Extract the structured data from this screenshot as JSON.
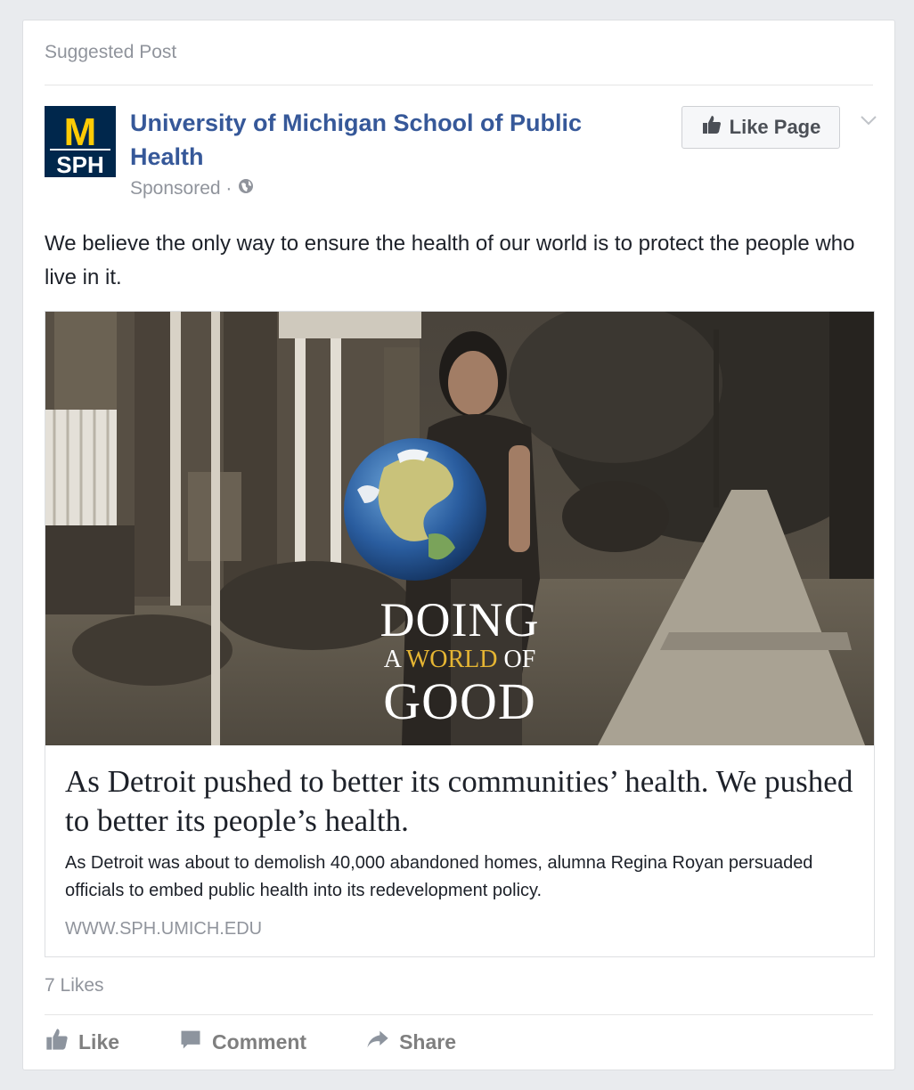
{
  "post": {
    "label": "Suggested Post",
    "page_name": "University of Michigan School of Public Health",
    "logo": {
      "top_text": "M",
      "bottom_text": "SPH",
      "bg_color": "#00274c",
      "accent_color": "#ffcb05"
    },
    "sponsored": "Sponsored ·",
    "like_page_label": "Like Page",
    "text": "We believe the only way to ensure the health of our world is to protect the people who live in it."
  },
  "link": {
    "image_overlay": {
      "line1": "DOING",
      "line2_a": "A ",
      "line2_b": "WORLD",
      "line2_c": " OF",
      "line3": "GOOD"
    },
    "headline": "As Detroit pushed to better its communities’ health. We pushed to better its people’s health.",
    "description": "As Detroit was about to demolish 40,000 abandoned homes, alumna Regina Royan persuaded officials to embed public health into its redevelopment policy.",
    "domain": "WWW.SPH.UMICH.EDU"
  },
  "footer": {
    "likes": "7 Likes",
    "actions": {
      "like": "Like",
      "comment": "Comment",
      "share": "Share"
    }
  },
  "icons": {
    "thumbs_up": "thumbs-up-icon",
    "comment": "comment-icon",
    "share": "share-arrow-icon",
    "globe": "globe-icon",
    "chevron": "chevron-down-icon"
  },
  "colors": {
    "page_bg": "#e9ebee",
    "link_blue": "#365899",
    "muted_text": "#90949c",
    "overlay_gold": "#e5b533"
  }
}
